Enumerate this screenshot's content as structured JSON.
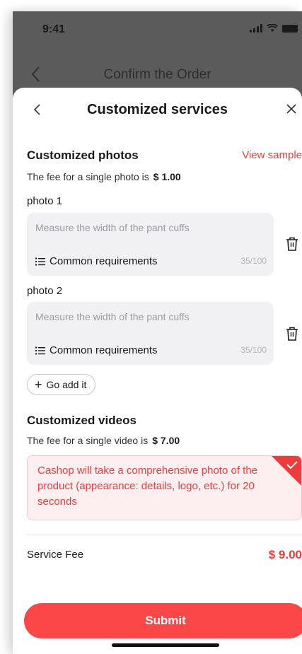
{
  "status_bar": {
    "time": "9:41"
  },
  "background_page": {
    "title": "Confirm the Order"
  },
  "sheet": {
    "title": "Customized services",
    "photos": {
      "title": "Customized photos",
      "view_sample": "View sample",
      "fee_text": "The fee for a single photo is",
      "fee_value": "$ 1.00",
      "items": [
        {
          "label": "photo 1",
          "placeholder": "Measure the width of the pant cuffs",
          "common": "Common requirements",
          "count": "35/100"
        },
        {
          "label": "photo 2",
          "placeholder": "Measure the width of the pant cuffs",
          "common": "Common requirements",
          "count": "35/100"
        }
      ],
      "add_label": "Go add it"
    },
    "videos": {
      "title": "Customized videos",
      "fee_text": "The fee for a single video is",
      "fee_value": "$ 7.00",
      "description": "Cashop will take a comprehensive photo of the product (appearance: details, logo, etc.) for 20 seconds",
      "selected": true
    },
    "service_fee": {
      "label": "Service Fee",
      "value": "$ 9.00"
    },
    "submit_label": "Submit"
  },
  "colors": {
    "accent": "#ee3b3b",
    "submit_bg": "#fb4748",
    "input_bg": "#f1f1f3",
    "video_card_bg": "#fdeef0"
  },
  "icons": [
    "back-icon",
    "close-icon",
    "list-icon",
    "trash-icon",
    "plus-icon",
    "checkmark-icon",
    "signal-icon",
    "wifi-icon",
    "battery-icon"
  ]
}
